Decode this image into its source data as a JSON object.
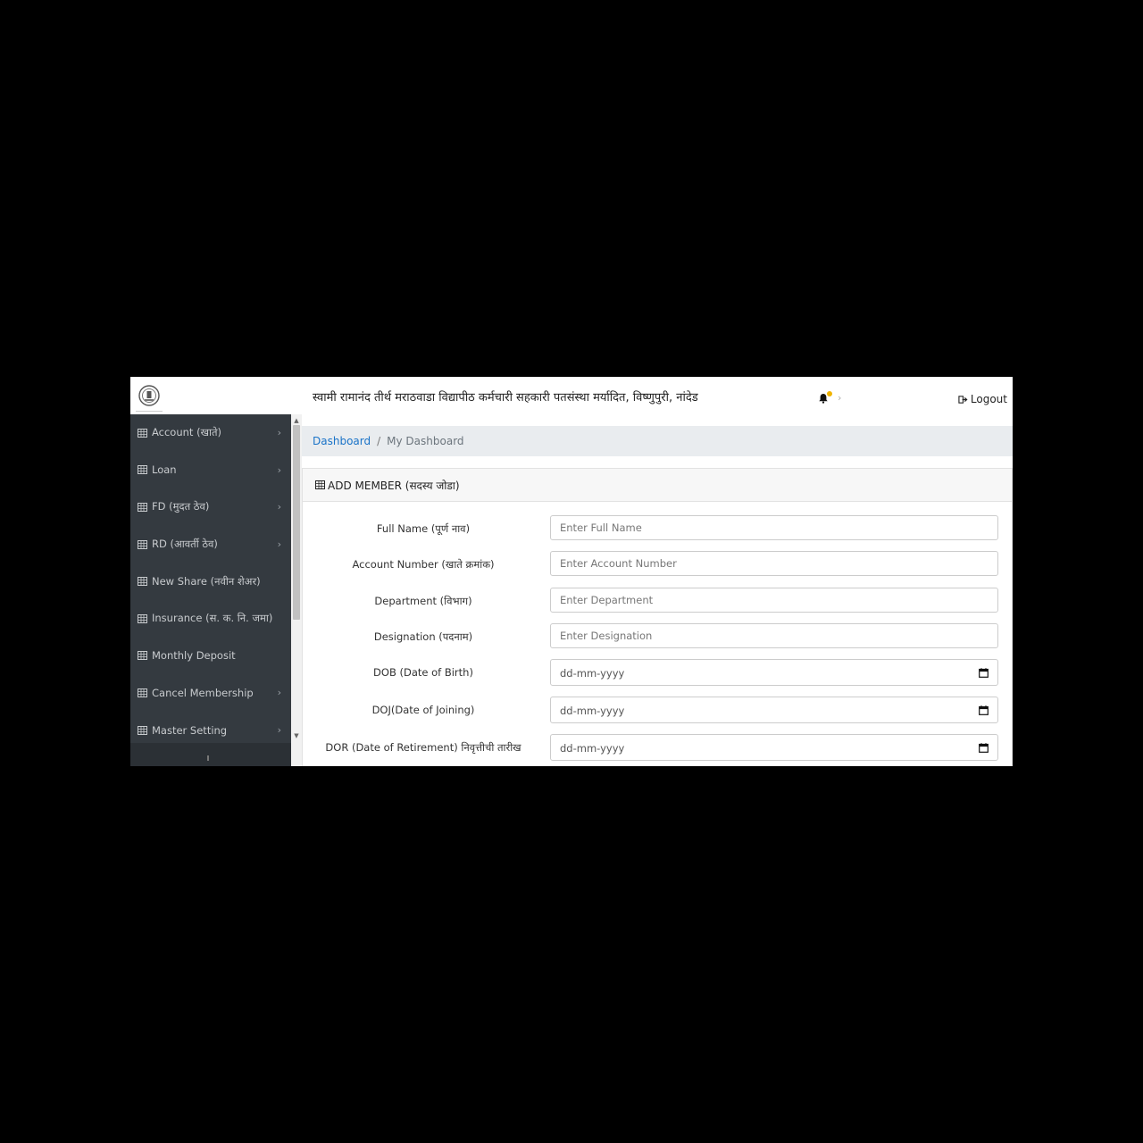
{
  "header": {
    "org_title": "स्वामी रामानंद तीर्थ मराठवाडा विद्यापीठ कर्मचारी सहकारी पतसंस्था मर्यादित, विष्णुपुरी, नांदेड",
    "chevron": "›",
    "logout_label": "Logout"
  },
  "sidebar": {
    "items": [
      {
        "label": "Account (खाते)",
        "has_submenu": true
      },
      {
        "label": "Loan",
        "has_submenu": true
      },
      {
        "label": "FD (मुदत ठेव)",
        "has_submenu": true
      },
      {
        "label": "RD (आवर्ती ठेव)",
        "has_submenu": true
      },
      {
        "label": "New Share (नवीन शेअर)",
        "has_submenu": false
      },
      {
        "label": "Insurance (स. क. नि. जमा)",
        "has_submenu": false
      },
      {
        "label": "Monthly Deposit",
        "has_submenu": false
      },
      {
        "label": "Cancel Membership",
        "has_submenu": true
      },
      {
        "label": "Master Setting",
        "has_submenu": true
      }
    ],
    "chevron": "›"
  },
  "breadcrumb": {
    "link": "Dashboard",
    "separator": "/",
    "current": "My Dashboard"
  },
  "card": {
    "title": "ADD MEMBER (सदस्य जोडा)"
  },
  "form": {
    "full_name": {
      "label": "Full Name (पूर्ण नाव)",
      "placeholder": "Enter Full Name"
    },
    "account_number": {
      "label": "Account Number (खाते क्रमांक)",
      "placeholder": "Enter Account Number"
    },
    "department": {
      "label": "Department (विभाग)",
      "placeholder": "Enter Department"
    },
    "designation": {
      "label": "Designation (पदनाम)",
      "placeholder": "Enter Designation"
    },
    "dob": {
      "label": "DOB (Date of Birth)",
      "value": "dd-mm-yyyy"
    },
    "doj": {
      "label": "DOJ(Date of Joining)",
      "value": "dd-mm-yyyy"
    },
    "dor": {
      "label": "DOR (Date of Retirement) निवृत्तीची तारीख",
      "value": "dd-mm-yyyy"
    }
  },
  "colors": {
    "sidebar_bg": "#343a40",
    "link_blue": "#1a73c8",
    "breadcrumb_bg": "#e9ecef",
    "notification_dot": "#f0b400"
  }
}
